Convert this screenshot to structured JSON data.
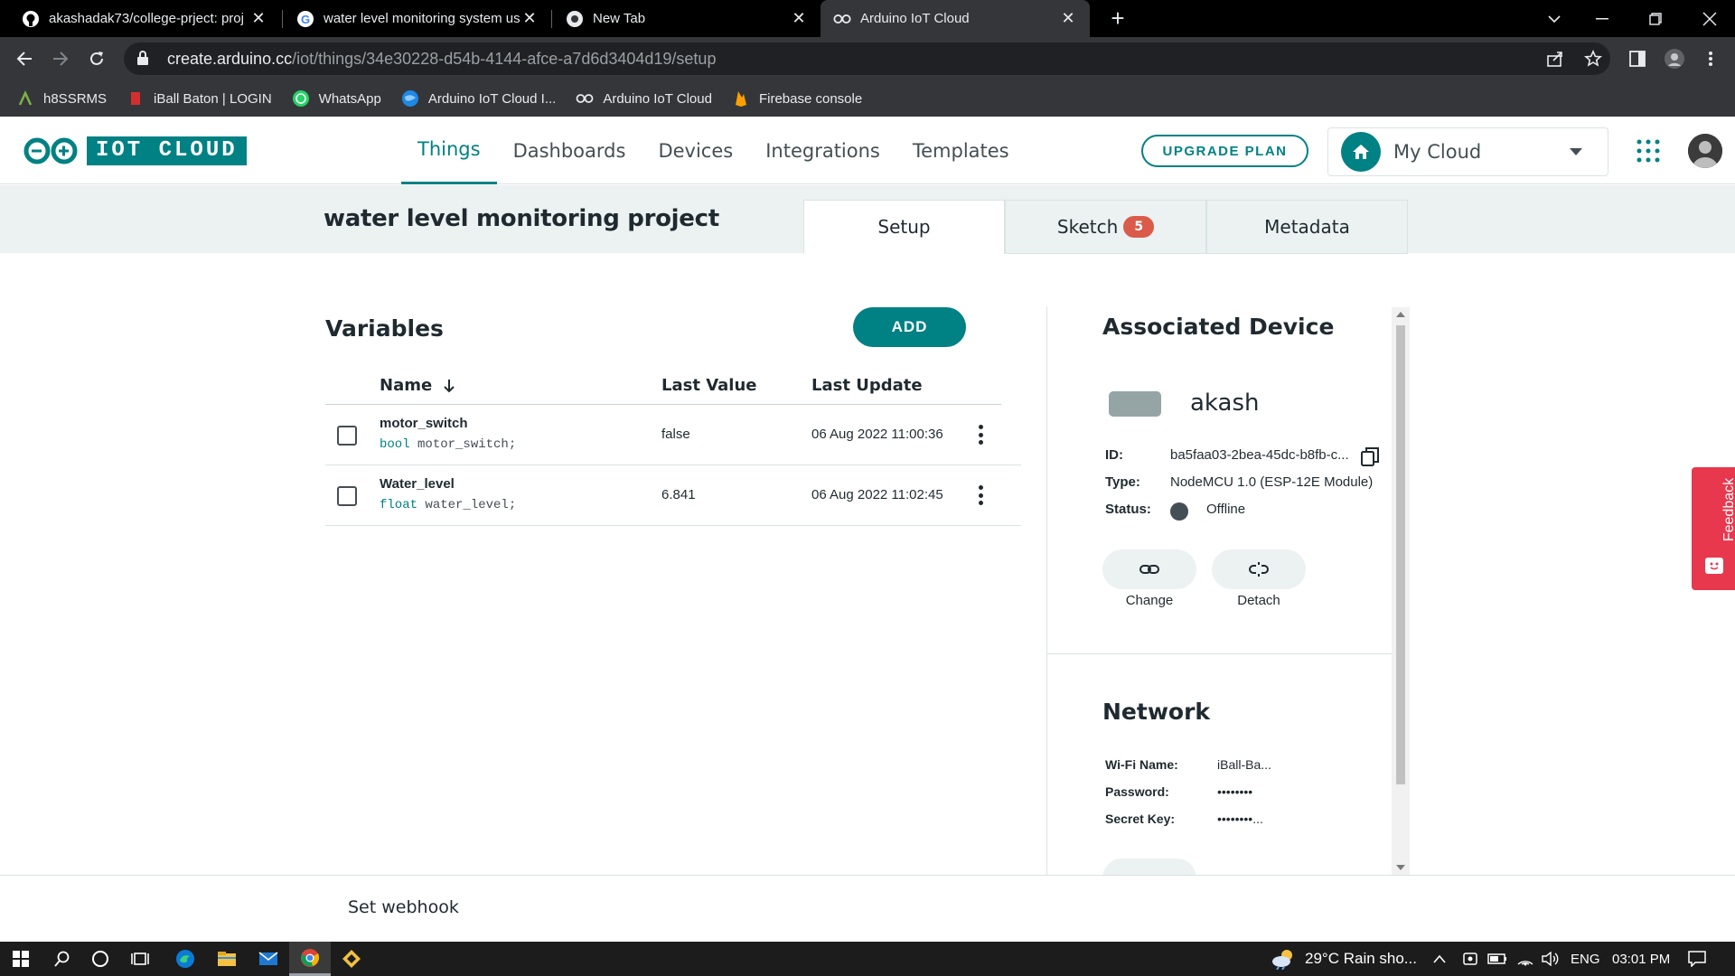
{
  "browser": {
    "tabs": [
      {
        "title": "akashadak73/college-prject: proj",
        "icon": "github-icon"
      },
      {
        "title": "water level monitoring system us",
        "icon": "google-icon"
      },
      {
        "title": "New Tab",
        "icon": "chrome-icon"
      },
      {
        "title": "Arduino IoT Cloud",
        "icon": "arduino-icon",
        "active": true
      }
    ],
    "url_host": "create.arduino.cc",
    "url_path": "/iot/things/34e30228-d54b-4144-afce-a7d6d3404d19/setup",
    "bookmarks": [
      {
        "label": "h8SSRMS",
        "icon": "bookmark-app-icon"
      },
      {
        "label": "iBall Baton | LOGIN",
        "icon": "iball-icon"
      },
      {
        "label": "WhatsApp",
        "icon": "whatsapp-icon"
      },
      {
        "label": "Arduino IoT Cloud I...",
        "icon": "globe-icon"
      },
      {
        "label": "Arduino IoT Cloud",
        "icon": "arduino-icon"
      },
      {
        "label": "Firebase console",
        "icon": "firebase-icon"
      }
    ]
  },
  "header": {
    "logo_text": "IOT CLOUD",
    "nav": [
      {
        "label": "Things",
        "active": true
      },
      {
        "label": "Dashboards"
      },
      {
        "label": "Devices"
      },
      {
        "label": "Integrations"
      },
      {
        "label": "Templates"
      }
    ],
    "upgrade_label": "UPGRADE PLAN",
    "cloud_label": "My Cloud"
  },
  "thing": {
    "title": "water level monitoring project",
    "tabs": {
      "setup": "Setup",
      "sketch": "Sketch",
      "sketch_badge": "5",
      "metadata": "Metadata"
    }
  },
  "variables": {
    "title": "Variables",
    "add_label": "ADD",
    "columns": {
      "name": "Name",
      "last_value": "Last Value",
      "last_update": "Last Update"
    },
    "rows": [
      {
        "name": "motor_switch",
        "type": "bool",
        "decl": "motor_switch;",
        "value": "false",
        "updated": "06 Aug 2022 11:00:36"
      },
      {
        "name": "Water_level",
        "type": "float",
        "decl": "water_level;",
        "value": "6.841",
        "updated": "06 Aug 2022 11:02:45"
      }
    ]
  },
  "device": {
    "title": "Associated Device",
    "name": "akash",
    "id_label": "ID:",
    "id": "ba5faa03-2bea-45dc-b8fb-c...",
    "type_label": "Type:",
    "type": "NodeMCU 1.0 (ESP-12E Module)",
    "status_label": "Status:",
    "status": "Offline",
    "change_label": "Change",
    "detach_label": "Detach"
  },
  "network": {
    "title": "Network",
    "wifi_label": "Wi-Fi Name:",
    "wifi": "iBall-Ba...",
    "password_label": "Password:",
    "password": "••••••••",
    "secret_label": "Secret Key:",
    "secret": "••••••••..."
  },
  "feedback_label": "Feedback",
  "webhook_label": "Set webhook",
  "taskbar": {
    "weather": "29°C  Rain sho...",
    "lang": "ENG",
    "time": "03:01 PM"
  },
  "colors": {
    "accent": "#008184",
    "badge": "#da5b4a",
    "feedback": "#e8384d"
  }
}
